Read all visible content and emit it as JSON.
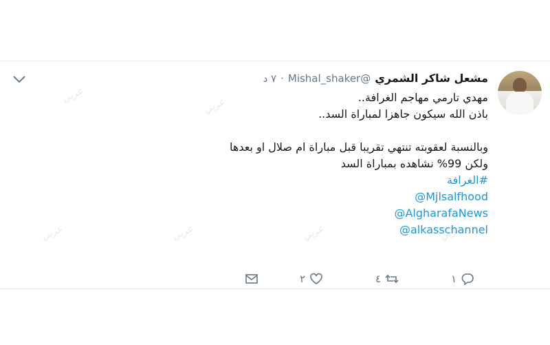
{
  "tweet": {
    "name": "مشعل شاكر الشمري",
    "handle": "@Mishal_shaker",
    "dot": "·",
    "time": "٧ د",
    "lines": [
      "مهدي تارمي مهاجم الغرافة..",
      "باذن الله سيكون جاهزا لمباراة السد.."
    ],
    "lines2": [
      "وبالنسبة لعقوبته تنتهي تقريبا قبل مباراة ام صلال او بعدها",
      "ولكن 99% نشاهده بمباراة السد"
    ],
    "hashtag": "#الغرافة",
    "mentions": [
      "@Mjlsalfhood",
      "@AlgharafaNews",
      "@alkasschannel"
    ]
  },
  "actions": {
    "reply_count": "١",
    "retweet_count": "٤",
    "like_count": "٢"
  },
  "watermark": "عربي"
}
